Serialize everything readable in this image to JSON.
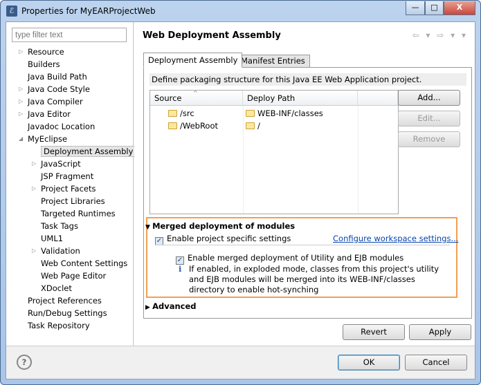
{
  "window": {
    "title": "Properties for MyEARProjectWeb",
    "minimize": "—",
    "maximize": "□",
    "close": "X",
    "close_color": "#c9463d"
  },
  "filter": {
    "placeholder": "type filter text"
  },
  "tree": [
    {
      "label": "Resource",
      "level": 0,
      "expandable": true
    },
    {
      "label": "Builders",
      "level": 0
    },
    {
      "label": "Java Build Path",
      "level": 0
    },
    {
      "label": "Java Code Style",
      "level": 0,
      "expandable": true
    },
    {
      "label": "Java Compiler",
      "level": 0,
      "expandable": true
    },
    {
      "label": "Java Editor",
      "level": 0,
      "expandable": true
    },
    {
      "label": "Javadoc Location",
      "level": 0
    },
    {
      "label": "MyEclipse",
      "level": 0,
      "expanded": true
    },
    {
      "label": "Deployment Assembly",
      "level": 1,
      "selected": true
    },
    {
      "label": "JavaScript",
      "level": 1,
      "expandable": true
    },
    {
      "label": "JSP Fragment",
      "level": 1
    },
    {
      "label": "Project Facets",
      "level": 1,
      "expandable": true
    },
    {
      "label": "Project Libraries",
      "level": 1
    },
    {
      "label": "Targeted Runtimes",
      "level": 1
    },
    {
      "label": "Task Tags",
      "level": 1
    },
    {
      "label": "UML1",
      "level": 1
    },
    {
      "label": "Validation",
      "level": 1,
      "expandable": true
    },
    {
      "label": "Web Content Settings",
      "level": 1
    },
    {
      "label": "Web Page Editor",
      "level": 1
    },
    {
      "label": "XDoclet",
      "level": 1
    },
    {
      "label": "Project References",
      "level": 0
    },
    {
      "label": "Run/Debug Settings",
      "level": 0
    },
    {
      "label": "Task Repository",
      "level": 0
    }
  ],
  "page": {
    "title": "Web Deployment Assembly",
    "nav": "⇦ ▾ ⇨ ▾ ▾"
  },
  "tabs": [
    {
      "label": "Deployment Assembly",
      "active": true
    },
    {
      "label": "Manifest Entries"
    }
  ],
  "description": "Define packaging structure for this Java EE Web Application project.",
  "table": {
    "columns": [
      "Source",
      "Deploy Path"
    ],
    "rows": [
      [
        "/src",
        "WEB-INF/classes"
      ],
      [
        "/WebRoot",
        "/"
      ]
    ]
  },
  "side_buttons": {
    "add": "Add...",
    "edit": "Edit...",
    "remove": "Remove"
  },
  "merged": {
    "heading": "Merged deployment of modules",
    "project_specific": "Enable project specific settings",
    "project_specific_checked": true,
    "workspace_link": "Configure workspace settings...",
    "enable_merged": "Enable merged deployment of Utility and EJB modules",
    "enable_merged_checked": true,
    "info": "If enabled, in exploded mode, classes from this project's utility and EJB modules will be merged into its WEB-INF/classes directory to enable hot-synching"
  },
  "advanced": "Advanced",
  "buttons": {
    "revert": "Revert",
    "apply": "Apply",
    "ok": "OK",
    "cancel": "Cancel",
    "help": "?"
  }
}
